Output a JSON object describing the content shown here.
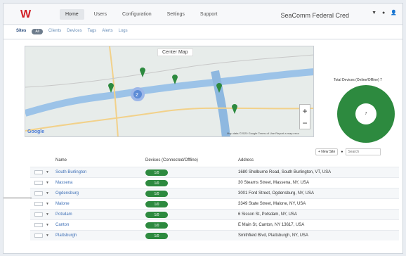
{
  "header": {
    "logo": "W",
    "nav": [
      {
        "label": "Home",
        "active": true
      },
      {
        "label": "Users",
        "active": false
      },
      {
        "label": "Configuration",
        "active": false
      },
      {
        "label": "Settings",
        "active": false
      },
      {
        "label": "Support",
        "active": false
      }
    ],
    "org_name": "SeaComm Federal Cred",
    "icons": [
      "chevron-down-icon",
      "info-icon",
      "user-icon"
    ]
  },
  "subtabs": [
    {
      "label": "Sites",
      "active": true
    },
    {
      "label": "Clients",
      "active": false
    },
    {
      "label": "Devices",
      "active": false
    },
    {
      "label": "Tags",
      "active": false
    },
    {
      "label": "Alerts",
      "active": false
    },
    {
      "label": "Logs",
      "active": false
    }
  ],
  "subtab_pill": "All",
  "map": {
    "title": "Center Map",
    "zoom_in": "+",
    "zoom_out": "−",
    "google": "Google",
    "attribution": "Map data ©2020 Google  Terms of Use  Report a map error",
    "cluster_count": "2"
  },
  "donut": {
    "title": "Total Devices (Online/Offline) 7",
    "center_label": "7"
  },
  "table_tools": {
    "new_site": "+ New Site",
    "search_placeholder": "Search"
  },
  "columns": {
    "name": "Name",
    "devices": "Devices (Connected/Offline)",
    "address": "Address"
  },
  "rows": [
    {
      "name": "South Burlington",
      "devices": "1/0",
      "address": "1680 Shelburne Road, South Burlington, VT, USA"
    },
    {
      "name": "Massena",
      "devices": "1/0",
      "address": "30 Stearns Street, Massena, NY, USA"
    },
    {
      "name": "Ogdensburg",
      "devices": "1/0",
      "address": "3001 Ford Street, Ogdensburg, NY, USA"
    },
    {
      "name": "Malone",
      "devices": "1/0",
      "address": "3349 State Street, Malone, NY, USA"
    },
    {
      "name": "Potsdam",
      "devices": "1/0",
      "address": "6 Sisson St, Potsdam, NY, USA"
    },
    {
      "name": "Canton",
      "devices": "1/0",
      "address": "E Main St, Canton, NY 13617, USA"
    },
    {
      "name": "Plattsburgh",
      "devices": "1/0",
      "address": "Smithfield Blvd, Plattsburgh, NY, USA"
    }
  ],
  "colors": {
    "accent": "#2d8a3f",
    "link": "#3d6fb6",
    "logo": "#d21f26"
  }
}
